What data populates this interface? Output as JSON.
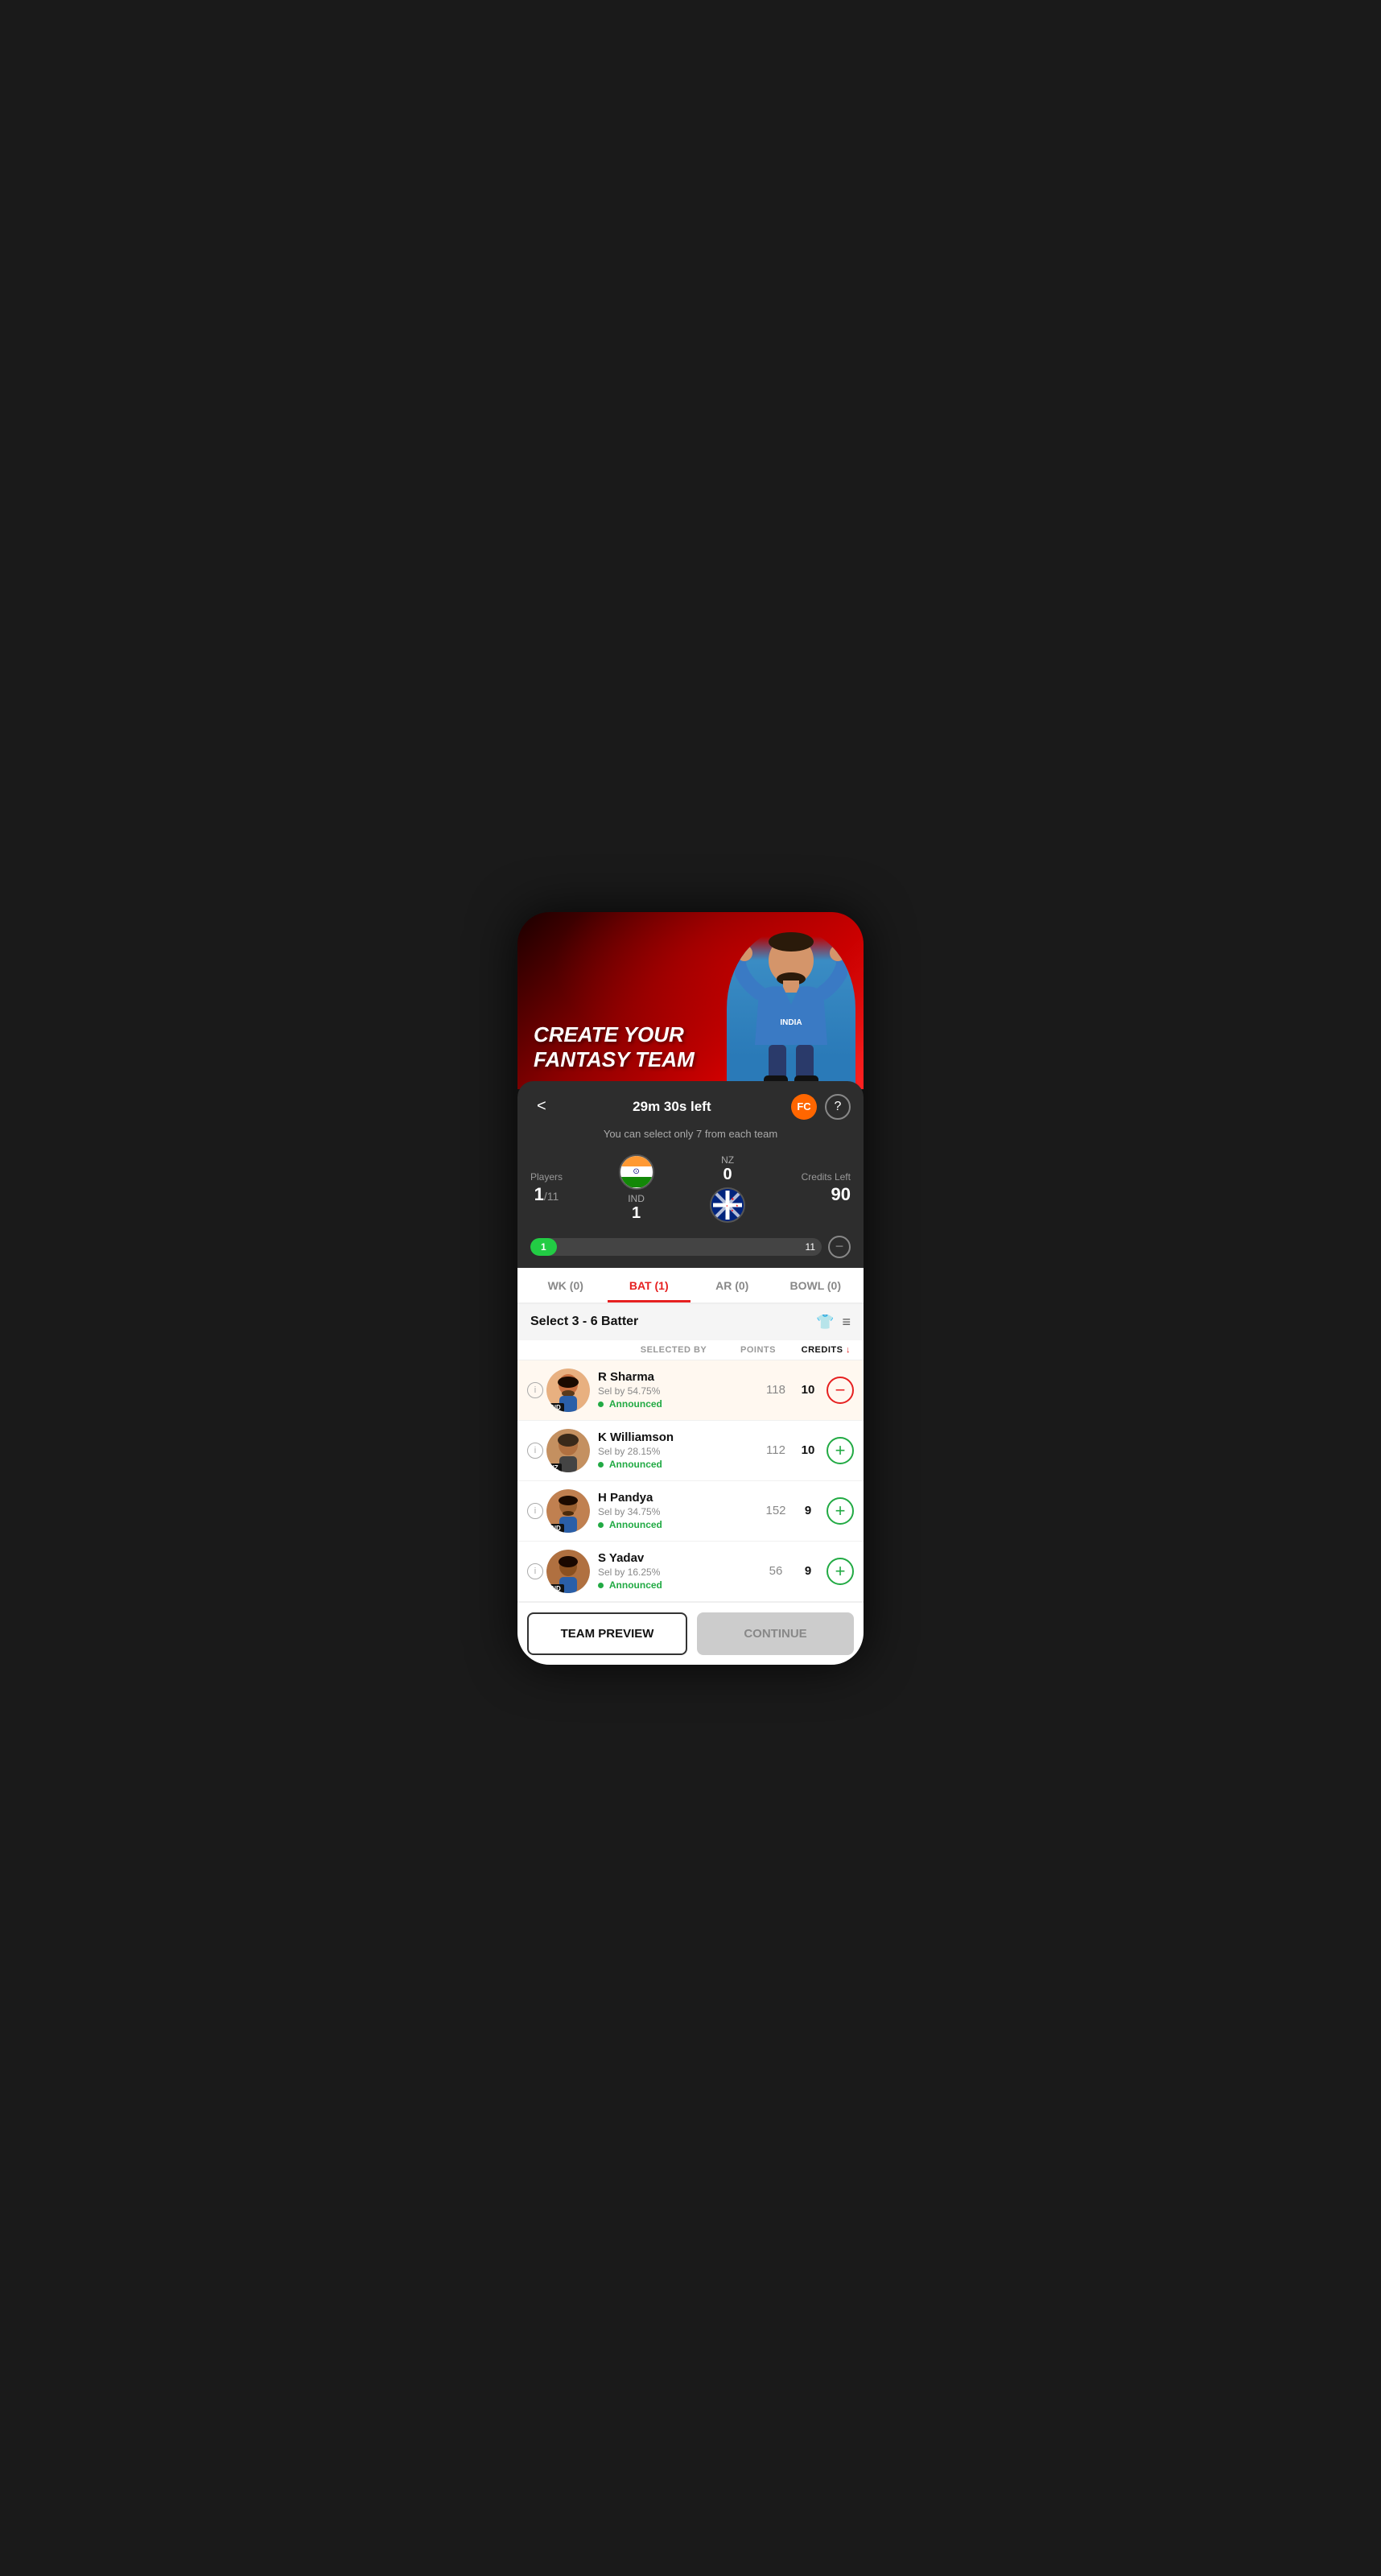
{
  "hero": {
    "title_line1": "CREATE YOUR",
    "title_line2": "FANTASY TEAM"
  },
  "header": {
    "timer": "29m 30s left",
    "fc_badge": "FC",
    "help_icon": "?",
    "back_icon": "<",
    "hint": "You can select only 7 from each team"
  },
  "score": {
    "players_label": "Players",
    "players_current": "1",
    "players_total": "/11",
    "ind_label": "IND",
    "ind_count": "1",
    "nz_label": "NZ",
    "nz_count": "0",
    "credits_label": "Credits Left",
    "credits_value": "90",
    "progress_start": "1",
    "progress_end": "11"
  },
  "tabs": [
    {
      "id": "wk",
      "label": "WK (0)",
      "active": false
    },
    {
      "id": "bat",
      "label": "BAT (1)",
      "active": true
    },
    {
      "id": "ar",
      "label": "AR (0)",
      "active": false
    },
    {
      "id": "bowl",
      "label": "BOWL (0)",
      "active": false
    }
  ],
  "section": {
    "title": "Select 3 - 6 Batter",
    "shirt_icon": "👕",
    "filter_icon": "≡"
  },
  "columns": {
    "selected_by": "SELECTED BY",
    "points": "POINTS",
    "credits": "CREDITS"
  },
  "players": [
    {
      "name": "R Sharma",
      "team": "IND",
      "sel_by": "Sel by 54.75%",
      "announced": "Announced",
      "points": "118",
      "credits": "10",
      "selected": true,
      "action": "remove"
    },
    {
      "name": "K Williamson",
      "team": "NZ",
      "sel_by": "Sel by 28.15%",
      "announced": "Announced",
      "points": "112",
      "credits": "10",
      "selected": false,
      "action": "add"
    },
    {
      "name": "H Pandya",
      "team": "IND",
      "sel_by": "Sel by 34.75%",
      "announced": "Announced",
      "points": "152",
      "credits": "9",
      "selected": false,
      "action": "add"
    },
    {
      "name": "S Yadav",
      "team": "IND",
      "sel_by": "Sel by 16.25%",
      "announced": "Announced",
      "points": "56",
      "credits": "9",
      "selected": false,
      "action": "add"
    }
  ],
  "buttons": {
    "team_preview": "TEAM PREVIEW",
    "continue": "CONTINUE"
  }
}
